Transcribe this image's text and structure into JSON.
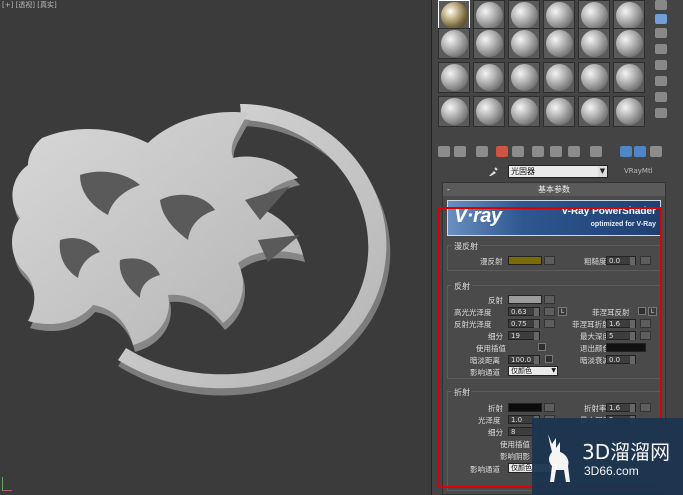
{
  "viewport": {
    "label": "[+] [透视] [真实]"
  },
  "editor": {
    "material_name": "光固器",
    "material_type": "VRayMtl"
  },
  "params": {
    "header": "基本参数",
    "banner": {
      "logo": "V·ray",
      "title": "V-Ray PowerShader",
      "subtitle": "optimized for V-Ray"
    },
    "diffuse": {
      "group": "漫反射",
      "diffuse_label": "漫反射",
      "diffuse_color": "#7a6a08",
      "roughness_label": "粗糙度",
      "roughness_value": "0.0"
    },
    "reflection": {
      "group": "反射",
      "reflect_label": "反射",
      "reflect_color": "#9c9c9c",
      "hilight_gloss_label": "高光光泽度",
      "hilight_gloss_value": "0.63",
      "L": "L",
      "fresnel_label": "菲涅耳反射",
      "refl_gloss_label": "反射光泽度",
      "refl_gloss_value": "0.75",
      "fresnel_ior_label": "菲涅耳折射率",
      "fresnel_ior_value": "1.6",
      "subdivs_label": "细分",
      "subdivs_value": "19",
      "max_depth_label": "最大深度",
      "max_depth_value": "5",
      "use_interp_label": "使用插值",
      "exit_color_label": "退出颜色",
      "exit_color": "#111111",
      "dim_dist_label": "暗淡距离",
      "dim_dist_value": "100.0",
      "dim_falloff_label": "暗淡衰减",
      "dim_falloff_value": "0.0",
      "affect_ch_label": "影响通道",
      "affect_ch_value": "仅颜色"
    },
    "refraction": {
      "group": "折射",
      "refract_label": "折射",
      "refract_color": "#0c0c0c",
      "ior_label": "折射率",
      "ior_value": "1.6",
      "gloss_label": "光泽度",
      "gloss_value": "1.0",
      "max_depth_label": "最大深度",
      "max_depth_value": "5",
      "subdivs_label": "细分",
      "subdivs_value": "8",
      "use_interp_label": "使用插值",
      "affect_shadow_label": "影响阴影",
      "affect_ch_label": "影响通道",
      "affect_ch_value": "仅颜色"
    }
  },
  "watermark": {
    "cn": "3D溜溜网",
    "url": "3D66.com"
  }
}
